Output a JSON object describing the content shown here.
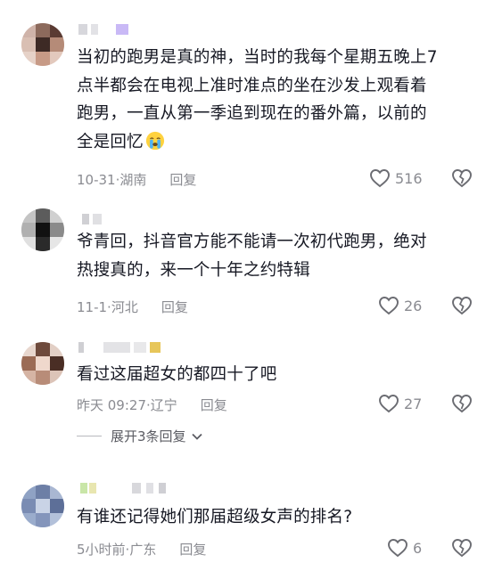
{
  "comments": [
    {
      "text_lines": [
        "当初的跑男是真的神，当时的我每个星期五晚上7",
        "点半都会在电视上准时准点的坐在沙发上观看着",
        "跑男，一直从第一季追到现在的番外篇，以前的",
        "全是回忆"
      ],
      "emoji": "crying-face",
      "date": "10-31",
      "location": "湖南",
      "reply_label": "回复",
      "likes": "516"
    },
    {
      "text_lines": [
        "爷青回，抖音官方能不能请一次初代跑男，绝对",
        "热搜真的，来一个十年之约特辑"
      ],
      "date": "11-1",
      "location": "河北",
      "reply_label": "回复",
      "likes": "26"
    },
    {
      "text_lines": [
        "看过这届超女的都四十了吧"
      ],
      "date": "昨天 09:27",
      "location": "辽宁",
      "reply_label": "回复",
      "likes": "27"
    },
    {
      "text_lines": [
        "有谁还记得她们那届超级女声的排名?"
      ],
      "date": "5小时前",
      "location": "广东",
      "reply_label": "回复",
      "likes": "6"
    }
  ],
  "expand_replies_label": "展开3条回复",
  "meta_separator": " · ",
  "colors": {
    "text": "#161823",
    "meta": "#8a8b91",
    "accent_purple": "#a78bfa"
  }
}
